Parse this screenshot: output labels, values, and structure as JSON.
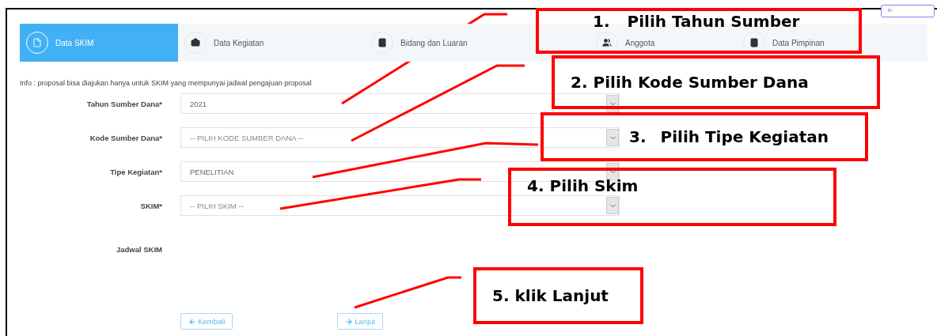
{
  "tabs": [
    {
      "label": "Data SKIM",
      "selected": true
    },
    {
      "label": "Data Kegiatan",
      "selected": false
    },
    {
      "label": "Bidang dan Luaran",
      "selected": false
    },
    {
      "label": "Anggota",
      "selected": false
    },
    {
      "label": "Data Pimpinan",
      "selected": false
    }
  ],
  "info": "Info : proposal bisa diajukan hanya untuk SKIM yang mempunyai jadwal pengajuan proposal",
  "form": {
    "fields": [
      {
        "label": "Tahun Sumber Dana*",
        "value": "2021"
      },
      {
        "label": "Kode Sumber Dana*",
        "placeholder": "-- PILIH KODE SUMBER DANA --"
      },
      {
        "label": "Tipe Kegiatan*",
        "value": "PENELITIAN"
      },
      {
        "label": "SKIM*",
        "placeholder": "-- PILIH SKIM --"
      }
    ],
    "schedule_label": "Jadwal SKIM"
  },
  "buttons": [
    {
      "label": "Kembali"
    },
    {
      "label": "Lanjut"
    }
  ],
  "callouts": [
    {
      "number": "1.",
      "text": "Pilih Tahun Sumber"
    },
    {
      "number": "2.",
      "text": "Pilih Kode Sumber Dana"
    },
    {
      "number": "3.",
      "text": "Pilih Tipe Kegiatan"
    },
    {
      "number": "4.",
      "text": "Pilih Skim"
    },
    {
      "number": "5.",
      "text": "klik Lanjut"
    }
  ]
}
